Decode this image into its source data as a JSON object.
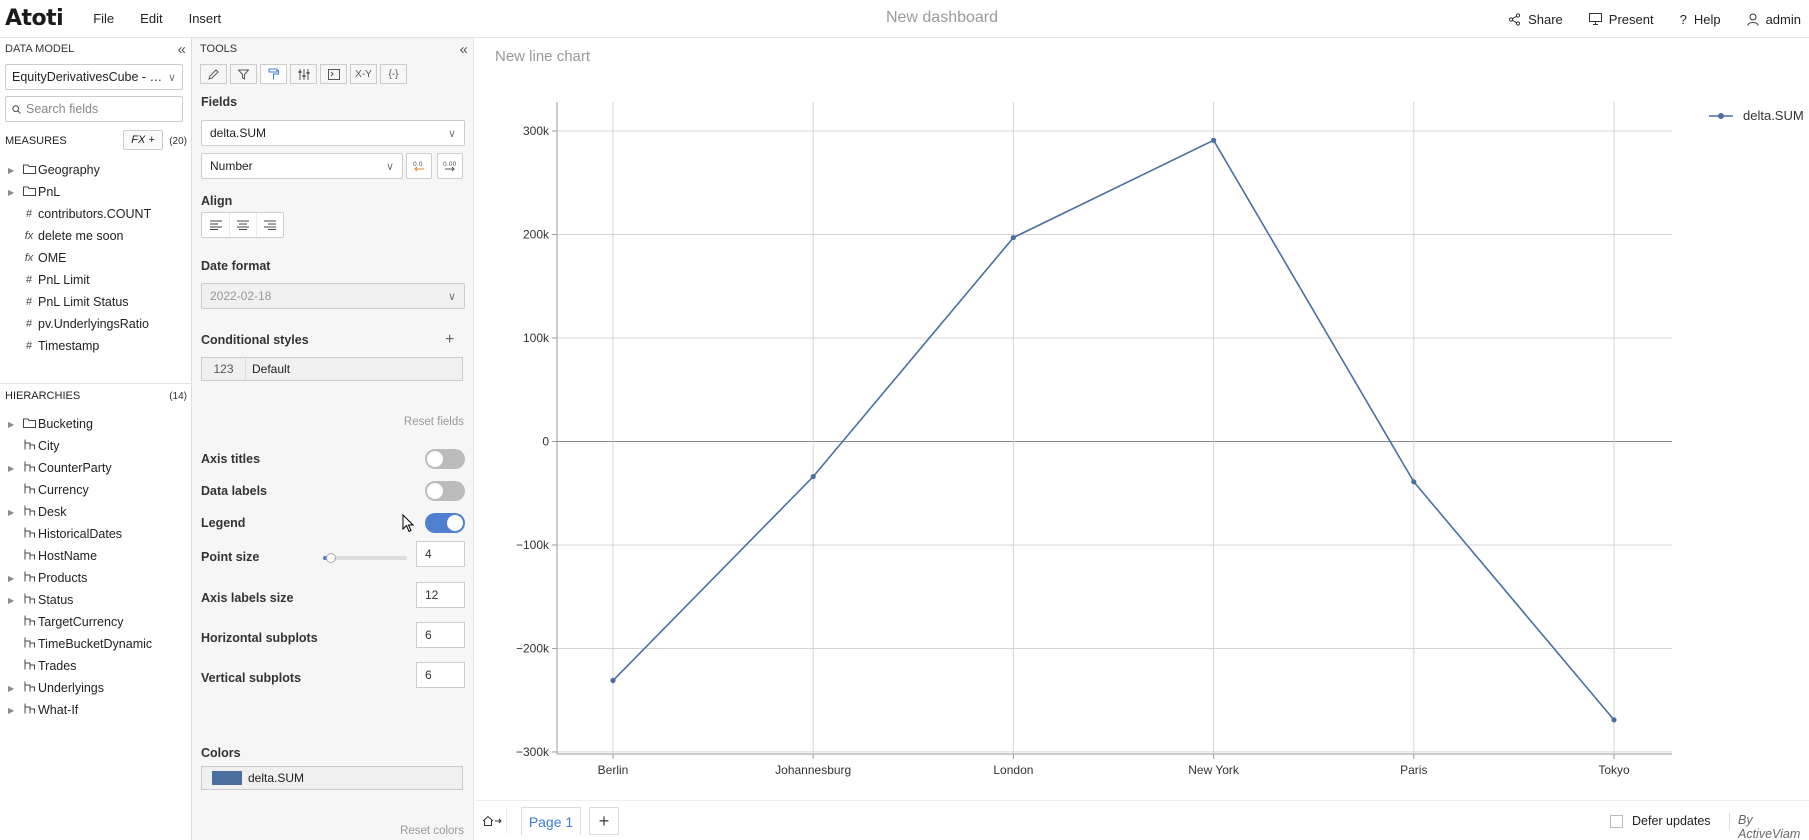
{
  "app": {
    "logo": "Atoti",
    "menu": [
      "File",
      "Edit",
      "Insert"
    ],
    "dashboard_title": "New dashboard",
    "actions": {
      "share": "Share",
      "present": "Present",
      "help": "Help",
      "user": "admin"
    }
  },
  "data_model": {
    "title": "DATA MODEL",
    "cube": "EquityDerivativesCube - R...",
    "search_placeholder": "Search fields",
    "measures_label": "MEASURES",
    "fx_label": "fx +",
    "measures_count": "(20)",
    "measures": [
      {
        "label": "Geography",
        "kind": "folder"
      },
      {
        "label": "PnL",
        "kind": "folder"
      },
      {
        "label": "contributors.COUNT",
        "kind": "measure"
      },
      {
        "label": "delete me soon",
        "kind": "calc"
      },
      {
        "label": "OME",
        "kind": "calc"
      },
      {
        "label": "PnL Limit",
        "kind": "measure"
      },
      {
        "label": "PnL Limit Status",
        "kind": "measure"
      },
      {
        "label": "pv.UnderlyingsRatio",
        "kind": "measure"
      },
      {
        "label": "Timestamp",
        "kind": "measure"
      }
    ],
    "hierarchies_label": "HIERARCHIES",
    "hierarchies_count": "(14)",
    "hierarchies": [
      {
        "label": "Bucketing",
        "kind": "folder"
      },
      {
        "label": "City",
        "kind": "hierarchy"
      },
      {
        "label": "CounterParty",
        "kind": "hierarchy",
        "expandable": true
      },
      {
        "label": "Currency",
        "kind": "hierarchy"
      },
      {
        "label": "Desk",
        "kind": "hierarchy",
        "expandable": true
      },
      {
        "label": "HistoricalDates",
        "kind": "hierarchy"
      },
      {
        "label": "HostName",
        "kind": "hierarchy"
      },
      {
        "label": "Products",
        "kind": "hierarchy",
        "expandable": true
      },
      {
        "label": "Status",
        "kind": "hierarchy",
        "expandable": true
      },
      {
        "label": "TargetCurrency",
        "kind": "hierarchy"
      },
      {
        "label": "TimeBucketDynamic",
        "kind": "hierarchy"
      },
      {
        "label": "Trades",
        "kind": "hierarchy"
      },
      {
        "label": "Underlyings",
        "kind": "hierarchy",
        "expandable": true
      },
      {
        "label": "What-If",
        "kind": "hierarchy",
        "expandable": true
      }
    ]
  },
  "tools": {
    "title": "TOOLS",
    "tabs": [
      "edit",
      "filter",
      "style",
      "sliders",
      "code",
      "X-Y",
      "{-}"
    ],
    "xy_label": "X-Y",
    "braces_label": "{-}",
    "fields_label": "Fields",
    "field_value": "delta.SUM",
    "format_value": "Number",
    "align_label": "Align",
    "date_format_label": "Date format",
    "date_format_value": "2022-02-18",
    "cond_styles_label": "Conditional styles",
    "cond_badge": "123",
    "cond_default": "Default",
    "reset_fields": "Reset fields",
    "axis_titles_label": "Axis titles",
    "axis_titles_on": false,
    "data_labels_label": "Data labels",
    "data_labels_on": false,
    "legend_label": "Legend",
    "legend_on": true,
    "point_size_label": "Point size",
    "point_size": "4",
    "point_size_fraction": 0.1,
    "axis_labels_size_label": "Axis labels size",
    "axis_labels_size": "12",
    "h_subplots_label": "Horizontal subplots",
    "h_subplots": "6",
    "v_subplots_label": "Vertical subplots",
    "v_subplots": "6",
    "colors_label": "Colors",
    "color_series": "delta.SUM",
    "series_color": "#4a6f9e",
    "reset_colors": "Reset colors"
  },
  "chart_title": "New line chart",
  "chart_data": {
    "type": "line",
    "categories": [
      "Berlin",
      "Johannesburg",
      "London",
      "New York",
      "Paris",
      "Tokyo"
    ],
    "series": [
      {
        "name": "delta.SUM",
        "values": [
          -231000,
          -34000,
          197000,
          291000,
          -39000,
          -269000
        ]
      }
    ],
    "yticks": [
      -300000,
      -200000,
      -100000,
      0,
      100000,
      200000,
      300000
    ],
    "ytick_labels": [
      "−300k",
      "−200k",
      "−100k",
      "0",
      "100k",
      "200k",
      "300k"
    ],
    "ylim": [
      -302000,
      328000
    ],
    "grid": true,
    "legend": "top-right",
    "color": "#4a6f9e"
  },
  "footer": {
    "page_tab": "Page 1",
    "add_page": "+",
    "defer_label": "Defer updates",
    "brand": "By ActiveViam"
  }
}
